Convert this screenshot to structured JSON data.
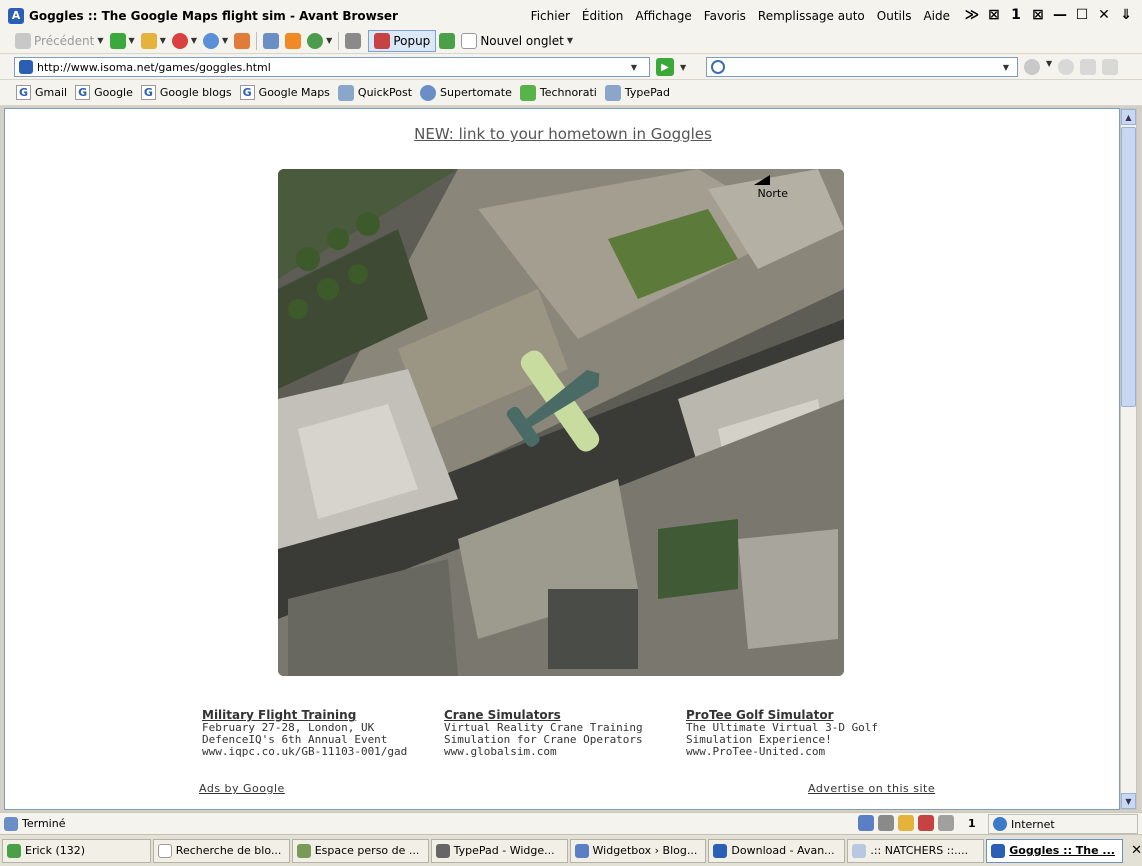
{
  "window": {
    "title": "Goggles :: The Google Maps flight sim - Avant Browser",
    "menu": [
      "Fichier",
      "Édition",
      "Affichage",
      "Favoris",
      "Remplissage auto",
      "Outils",
      "Aide"
    ],
    "controls": [
      "≫",
      "⊠",
      "1",
      "⊠",
      "—",
      "☐",
      "✕",
      "⇓"
    ]
  },
  "toolbar": {
    "back_label": "Précédent",
    "popup_label": "Popup",
    "new_tab_label": "Nouvel onglet"
  },
  "address": {
    "url": "http://www.isoma.net/games/goggles.html",
    "search_placeholder": ""
  },
  "bookmarks": [
    {
      "label": "Gmail"
    },
    {
      "label": "Google"
    },
    {
      "label": "Google blogs"
    },
    {
      "label": "Google Maps"
    },
    {
      "label": "QuickPost"
    },
    {
      "label": "Supertomate"
    },
    {
      "label": "Technorati"
    },
    {
      "label": "TypePad"
    }
  ],
  "page": {
    "new_link": "NEW: link to your hometown in Goggles",
    "map_north": "Norte",
    "ads": [
      {
        "title": "Military Flight Training",
        "desc": "February 27-28, London, UK DefenceIQ's 6th Annual Event",
        "url": "www.iqpc.co.uk/GB-11103-001/gad"
      },
      {
        "title": "Crane Simulators",
        "desc": "Virtual Reality Crane Training Simulation for Crane Operators",
        "url": "www.globalsim.com"
      },
      {
        "title": "ProTee Golf Simulator",
        "desc": "The Ultimate Virtual 3-D Golf Simulation Experience!",
        "url": "www.ProTee-United.com"
      }
    ],
    "ads_by": "Ads by Google",
    "advertise": "Advertise on this site"
  },
  "status": {
    "text": "Terminé",
    "count": "1",
    "zone": "Internet"
  },
  "taskbar": [
    {
      "label": "Erick (132)",
      "active": false
    },
    {
      "label": "Recherche de blo...",
      "active": false
    },
    {
      "label": "Espace perso de ...",
      "active": false
    },
    {
      "label": "TypePad - Widge...",
      "active": false
    },
    {
      "label": "Widgetbox › Blog...",
      "active": false
    },
    {
      "label": "Download - Avan...",
      "active": false
    },
    {
      "label": ".:: NATCHERS ::....",
      "active": false
    },
    {
      "label": "Goggles :: The ...",
      "active": true
    }
  ]
}
